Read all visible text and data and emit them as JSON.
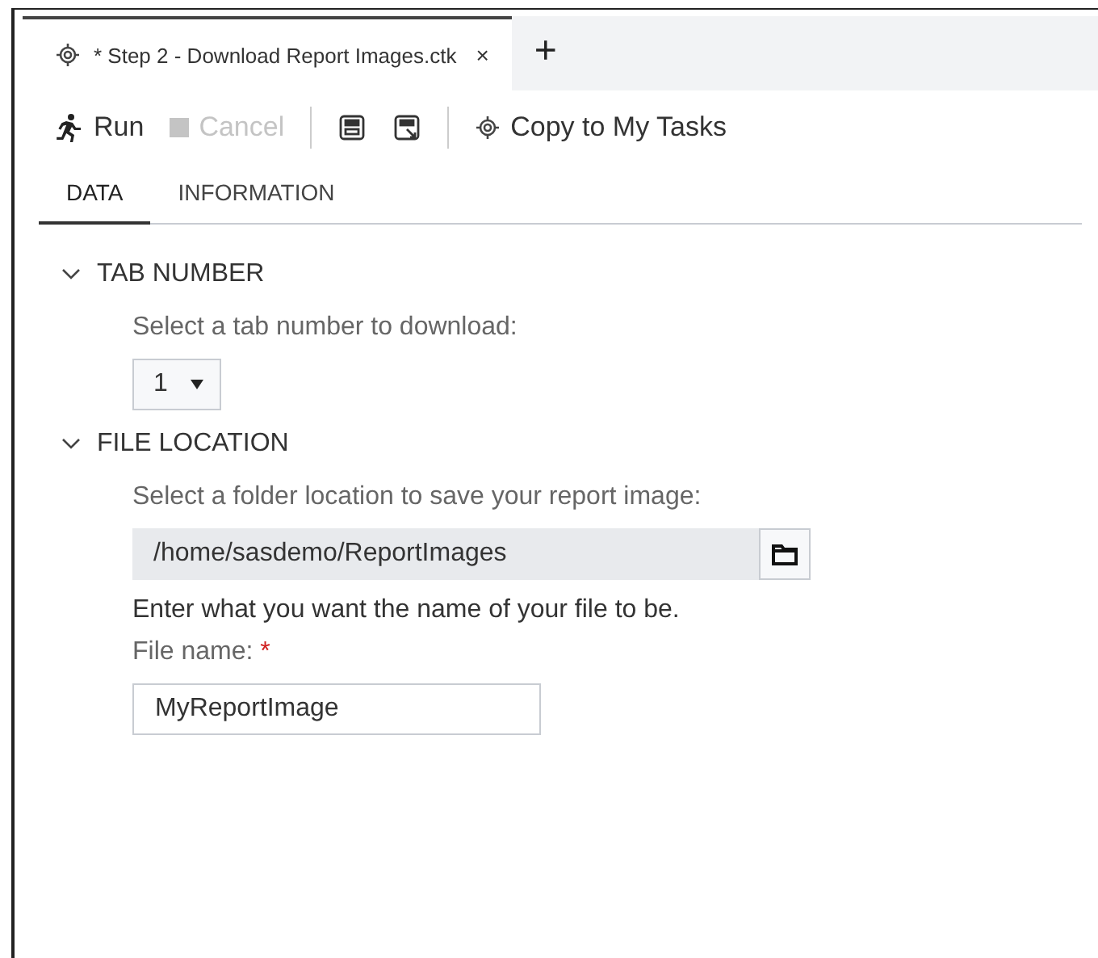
{
  "editor_tabs": [
    {
      "label": "* Step 2 - Download Report Images.ctk",
      "selected": true,
      "close": "×"
    }
  ],
  "add_tab": "+",
  "toolbar": [
    {
      "kind": "run",
      "label": "Run",
      "disabled": false
    },
    {
      "kind": "cancel",
      "label": "Cancel",
      "disabled": true
    },
    {
      "kind": "separator"
    },
    {
      "kind": "save"
    },
    {
      "kind": "save-as"
    },
    {
      "kind": "separator"
    },
    {
      "kind": "copy",
      "label": "Copy to My Tasks",
      "disabled": false
    }
  ],
  "tabs": [
    {
      "label": "DATA",
      "selected": true
    },
    {
      "label": "INFORMATION",
      "selected": false
    }
  ],
  "sections": [
    {
      "title": "TAB NUMBER",
      "expanded": true,
      "controls": [
        {
          "kind": "prompt",
          "text": "Select a tab number to download:"
        },
        {
          "kind": "select",
          "value": "1"
        }
      ]
    },
    {
      "title": "FILE LOCATION",
      "expanded": true,
      "controls": [
        {
          "kind": "prompt",
          "text": "Select a folder location to save your report image:"
        },
        {
          "kind": "folder",
          "value": "/home/sasdemo/ReportImages"
        },
        {
          "kind": "text",
          "text": "Enter what you want the name of your file to be."
        },
        {
          "kind": "label",
          "text": "File name:",
          "required": true,
          "marker": "*"
        },
        {
          "kind": "input",
          "value": "MyReportImage"
        }
      ]
    }
  ]
}
